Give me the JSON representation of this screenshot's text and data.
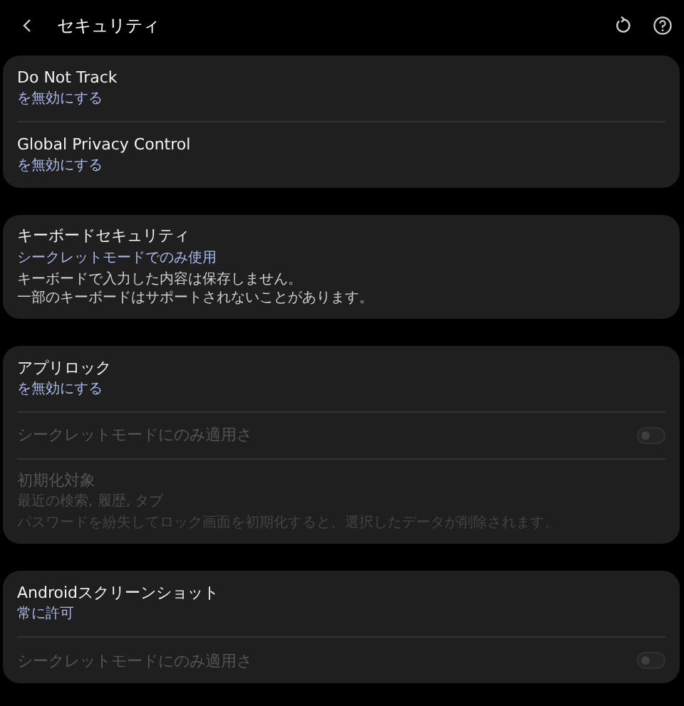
{
  "header": {
    "title": "セキュリティ"
  },
  "cards": [
    {
      "items": [
        {
          "kind": "option",
          "title": "Do Not Track",
          "value": "を無効にする",
          "disabled": false
        },
        {
          "kind": "option",
          "title": "Global Privacy Control",
          "value": "を無効にする",
          "disabled": false
        }
      ]
    },
    {
      "items": [
        {
          "kind": "option",
          "title": "キーボードセキュリティ",
          "value": "シークレットモードでのみ使用",
          "description": [
            "キーボードで入力した内容は保存しません。",
            "一部のキーボードはサポートされないことがあります。"
          ],
          "disabled": false
        }
      ]
    },
    {
      "items": [
        {
          "kind": "option",
          "title": "アプリロック",
          "value": "を無効にする",
          "disabled": false
        },
        {
          "kind": "toggle",
          "title": "シークレットモードにのみ適用さ",
          "on": false,
          "disabled": true
        },
        {
          "kind": "option",
          "title": "初期化対象",
          "value": "最近の検索, 履歴, タブ",
          "description": [
            "パスワードを紛失してロック画面を初期化すると、選択したデータが削除されます。"
          ],
          "disabled": true
        }
      ]
    },
    {
      "items": [
        {
          "kind": "option",
          "title": "Androidスクリーンショット",
          "value": "常に許可",
          "disabled": false
        },
        {
          "kind": "toggle",
          "title": "シークレットモードにのみ適用さ",
          "on": false,
          "disabled": true
        }
      ]
    }
  ]
}
